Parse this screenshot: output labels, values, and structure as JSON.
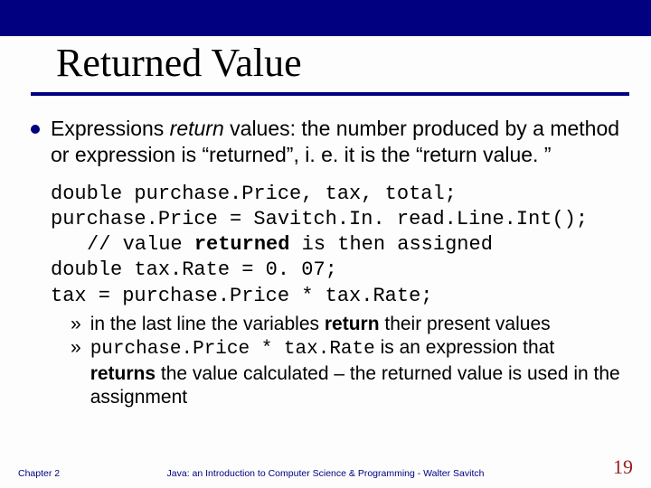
{
  "title": "Returned Value",
  "body": {
    "pre": "Expressions ",
    "ital": "return",
    "post": " values: the number produced by a method or expression is “returned”, i. e. it is the “return value. ”"
  },
  "code": {
    "l1": "double purchase.Price, tax, total;",
    "l2": "purchase.Price = Savitch.In. read.Line.Int();",
    "l3a": "// value ",
    "l3b": "returned",
    "l3c": " is then assigned",
    "l4": "double tax.Rate = 0. 07;",
    "l5": "tax = purchase.Price * tax.Rate;"
  },
  "subs": {
    "s1a": "in the last line the variables ",
    "s1b": "return",
    "s1c": " their present values",
    "s2a": "purchase.Price * tax.Rate",
    "s2b": " is an expression that ",
    "s2c": "returns",
    "s2d": " the value calculated – the returned value is used in the assignment"
  },
  "footer": {
    "left": "Chapter 2",
    "center": "Java: an Introduction to Computer Science & Programming - Walter Savitch",
    "page": "19"
  },
  "glyphs": {
    "raquo": "»"
  }
}
